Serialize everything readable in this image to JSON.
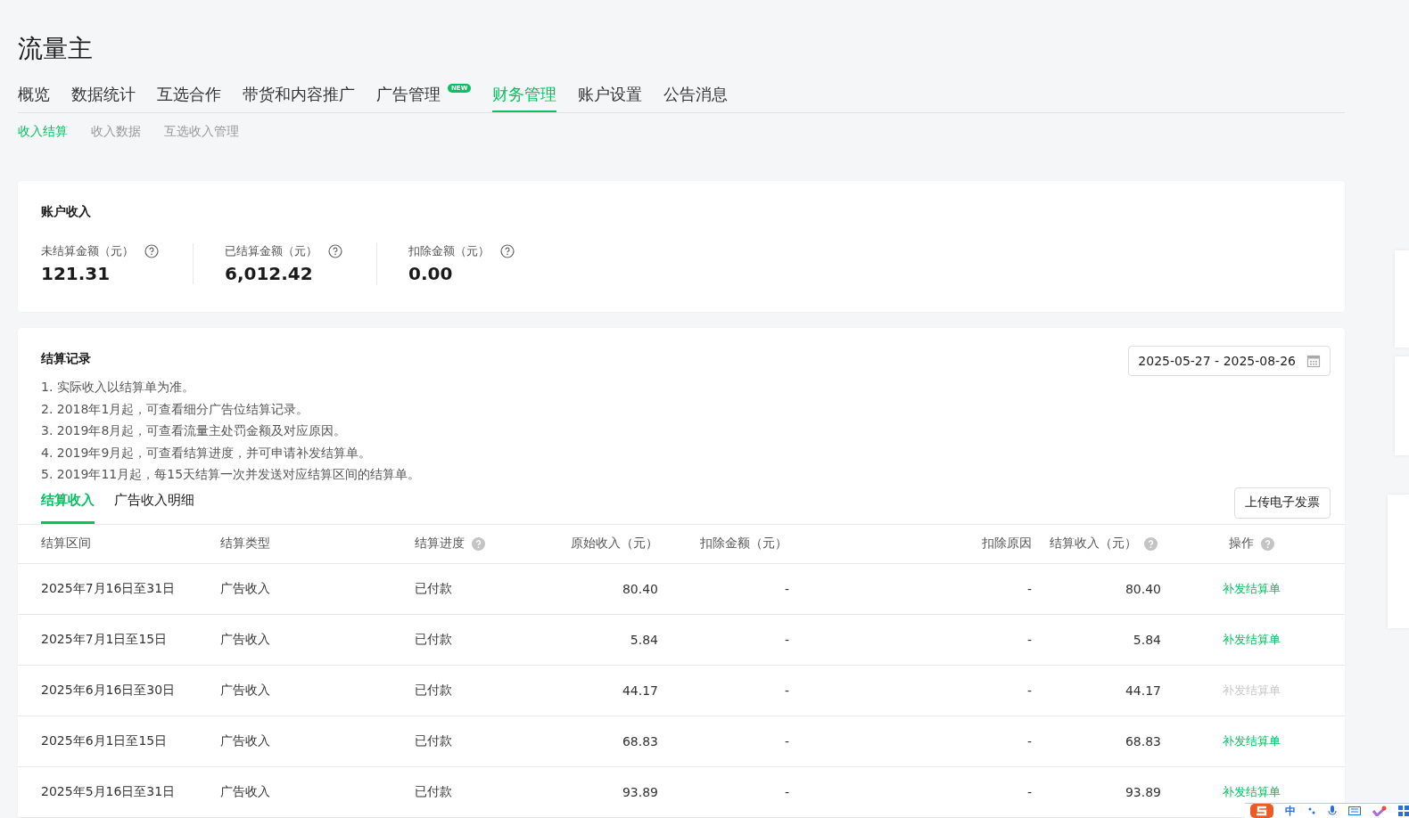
{
  "app_title": "流量主",
  "nav_tabs": [
    {
      "label": "概览",
      "selected": false
    },
    {
      "label": "数据统计",
      "selected": false
    },
    {
      "label": "互选合作",
      "selected": false
    },
    {
      "label": "带货和内容推广",
      "selected": false
    },
    {
      "label": "广告管理",
      "selected": false,
      "badge": "NEW"
    },
    {
      "label": "财务管理",
      "selected": true
    },
    {
      "label": "账户设置",
      "selected": false
    },
    {
      "label": "公告消息",
      "selected": false
    }
  ],
  "sub_tabs": [
    {
      "label": "收入结算",
      "selected": true
    },
    {
      "label": "收入数据",
      "selected": false
    },
    {
      "label": "互选收入管理",
      "selected": false
    }
  ],
  "account_income": {
    "title": "账户收入",
    "stats": [
      {
        "label": "未结算金额（元）",
        "value": "121.31"
      },
      {
        "label": "已结算金额（元）",
        "value": "6,012.42"
      },
      {
        "label": "扣除金额（元）",
        "value": "0.00"
      }
    ]
  },
  "records": {
    "title": "结算记录",
    "date_range": "2025-05-27 - 2025-08-26",
    "notes": [
      "1. 实际收入以结算单为准。",
      "2. 2018年1月起，可查看细分广告位结算记录。",
      "3. 2019年8月起，可查看流量主处罚金额及对应原因。",
      "4. 2019年9月起，可查看结算进度，并可申请补发结算单。",
      "5. 2019年11月起，每15天结算一次并发送对应结算区间的结算单。"
    ],
    "tabs": [
      {
        "label": "结算收入",
        "selected": true
      },
      {
        "label": "广告收入明细",
        "selected": false
      }
    ],
    "upload_button": "上传电子发票",
    "table": {
      "columns": [
        {
          "label": "结算区间",
          "help": false
        },
        {
          "label": "结算类型",
          "help": false
        },
        {
          "label": "结算进度",
          "help": true
        },
        {
          "label": "原始收入（元）",
          "help": false
        },
        {
          "label": "扣除金额（元）",
          "help": false
        },
        {
          "label": "扣除原因",
          "help": false
        },
        {
          "label": "结算收入（元）",
          "help": true
        },
        {
          "label": "操作",
          "help": true
        }
      ],
      "rows": [
        {
          "period": "2025年7月16日至31日",
          "type": "广告收入",
          "progress": "已付款",
          "original": "80.40",
          "deducted": "-",
          "reason": "-",
          "income": "80.40",
          "action": "补发结算单",
          "disabled": false
        },
        {
          "period": "2025年7月1日至15日",
          "type": "广告收入",
          "progress": "已付款",
          "original": "5.84",
          "deducted": "-",
          "reason": "-",
          "income": "5.84",
          "action": "补发结算单",
          "disabled": false
        },
        {
          "period": "2025年6月16日至30日",
          "type": "广告收入",
          "progress": "已付款",
          "original": "44.17",
          "deducted": "-",
          "reason": "-",
          "income": "44.17",
          "action": "补发结算单",
          "disabled": true
        },
        {
          "period": "2025年6月1日至15日",
          "type": "广告收入",
          "progress": "已付款",
          "original": "68.83",
          "deducted": "-",
          "reason": "-",
          "income": "68.83",
          "action": "补发结算单",
          "disabled": false
        },
        {
          "period": "2025年5月16日至31日",
          "type": "广告收入",
          "progress": "已付款",
          "original": "93.89",
          "deducted": "-",
          "reason": "-",
          "income": "93.89",
          "action": "补发结算单",
          "disabled": false
        }
      ]
    }
  },
  "ime_bar": {
    "mode": "中"
  }
}
